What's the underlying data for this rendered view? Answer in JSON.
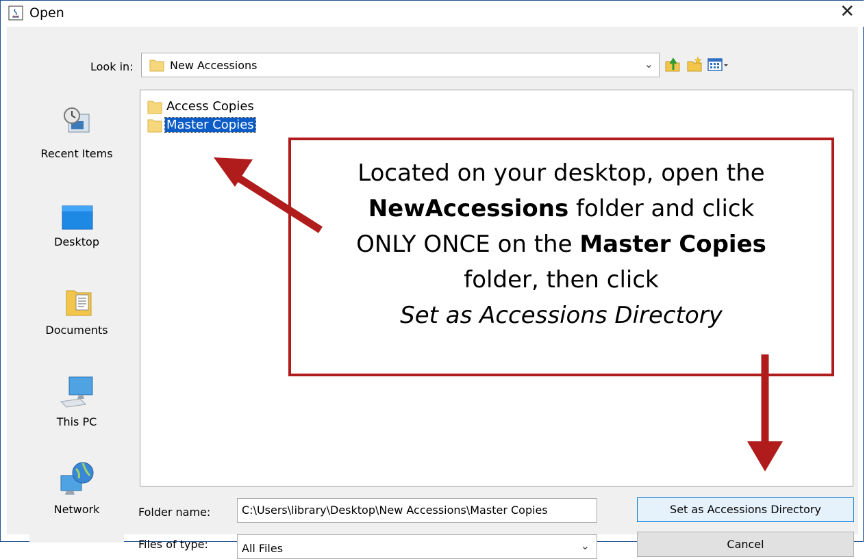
{
  "window": {
    "title": "Open",
    "close_glyph": "✕"
  },
  "toolbar": {
    "look_in_label": "Look in:",
    "look_in_value": "New Accessions",
    "icons": [
      "up-one-level-icon",
      "create-new-folder-icon",
      "view-menu-icon"
    ]
  },
  "places": [
    {
      "label": "Recent Items",
      "icon": "recent-items-icon"
    },
    {
      "label": "Desktop",
      "icon": "desktop-icon"
    },
    {
      "label": "Documents",
      "icon": "documents-icon"
    },
    {
      "label": "This PC",
      "icon": "this-pc-icon"
    },
    {
      "label": "Network",
      "icon": "network-icon"
    }
  ],
  "files": [
    {
      "name": "Access Copies",
      "selected": false
    },
    {
      "name": "Master Copies",
      "selected": true
    }
  ],
  "form": {
    "folder_name_label": "Folder name:",
    "folder_name_value": "C:\\Users\\library\\Desktop\\New Accessions\\Master Copies",
    "files_of_type_label": "Files of type:",
    "files_of_type_value": "All Files"
  },
  "buttons": {
    "set_directory": "Set as Accessions Directory",
    "cancel": "Cancel"
  },
  "callout": {
    "line1": "Located on your desktop, open the",
    "bold1": "NewAccessions",
    "line2_rest": " folder and click",
    "line3_start": "ONLY ONCE on the ",
    "bold2": "Master Copies",
    "line4": "folder, then click",
    "italic": "Set as Accessions Directory"
  },
  "colors": {
    "accent": "#0b5cc6",
    "callout_border": "#b01c1c",
    "arrow": "#b01c1c",
    "default_button_border": "#0078d7"
  }
}
